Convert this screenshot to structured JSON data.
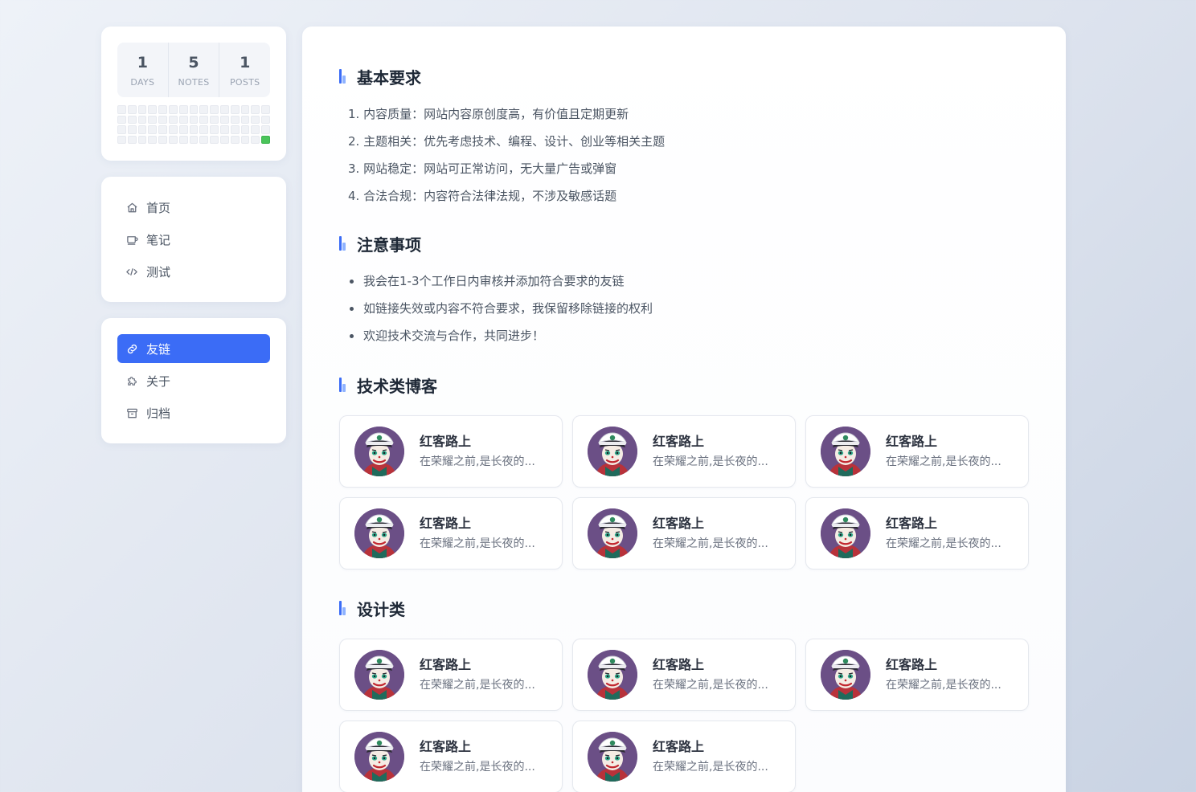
{
  "stats": [
    {
      "value": "1",
      "label": "DAYS"
    },
    {
      "value": "5",
      "label": "NOTES"
    },
    {
      "value": "1",
      "label": "POSTS"
    }
  ],
  "heatmap": {
    "columns": 15,
    "rows": 4,
    "active_cells": [
      59
    ],
    "active_color": "#4ac45a"
  },
  "nav_primary": [
    {
      "label": "首页",
      "icon": "home-icon"
    },
    {
      "label": "笔记",
      "icon": "coffee-cup-icon"
    },
    {
      "label": "测试",
      "icon": "code-icon"
    }
  ],
  "nav_secondary": [
    {
      "label": "友链",
      "icon": "link-icon",
      "active": true
    },
    {
      "label": "关于",
      "icon": "puzzle-icon"
    },
    {
      "label": "归档",
      "icon": "archive-box-icon"
    }
  ],
  "accent_color": "#3b6cf6",
  "sections": {
    "requirements": {
      "title": "基本要求",
      "items": [
        "1. 内容质量：网站内容原创度高，有价值且定期更新",
        "2. 主题相关：优先考虑技术、编程、设计、创业等相关主题",
        "3. 网站稳定：网站可正常访问，无大量广告或弹窗",
        "4. 合法合规：内容符合法律法规，不涉及敏感话题"
      ]
    },
    "notes": {
      "title": "注意事项",
      "items": [
        "我会在1-3个工作日内审核并添加符合要求的友链",
        "如链接失效或内容不符合要求，我保留移除链接的权利",
        "欢迎技术交流与合作，共同进步！"
      ]
    },
    "tech": {
      "title": "技术类博客",
      "friends": [
        {
          "name": "红客路上",
          "desc": "在荣耀之前,是长夜的..."
        },
        {
          "name": "红客路上",
          "desc": "在荣耀之前,是长夜的..."
        },
        {
          "name": "红客路上",
          "desc": "在荣耀之前,是长夜的..."
        },
        {
          "name": "红客路上",
          "desc": "在荣耀之前,是长夜的..."
        },
        {
          "name": "红客路上",
          "desc": "在荣耀之前,是长夜的..."
        },
        {
          "name": "红客路上",
          "desc": "在荣耀之前,是长夜的..."
        }
      ]
    },
    "design": {
      "title": "设计类",
      "friends": [
        {
          "name": "红客路上",
          "desc": "在荣耀之前,是长夜的..."
        },
        {
          "name": "红客路上",
          "desc": "在荣耀之前,是长夜的..."
        },
        {
          "name": "红客路上",
          "desc": "在荣耀之前,是长夜的..."
        },
        {
          "name": "红客路上",
          "desc": "在荣耀之前,是长夜的..."
        },
        {
          "name": "红客路上",
          "desc": "在荣耀之前,是长夜的..."
        }
      ]
    }
  }
}
